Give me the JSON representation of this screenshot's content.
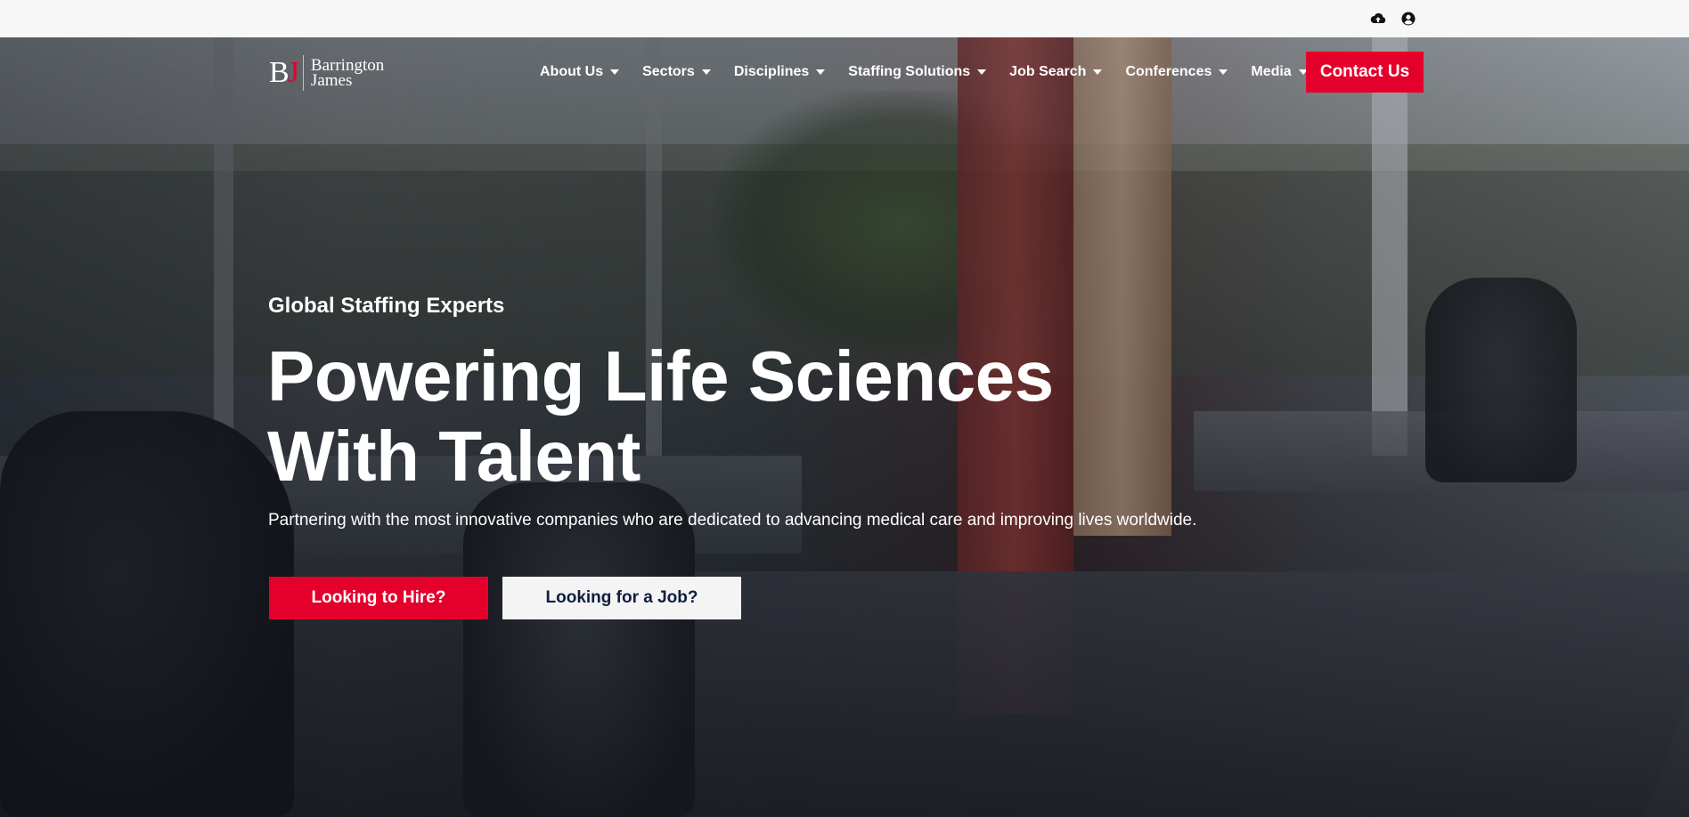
{
  "topbar": {
    "icons": [
      "cloud-upload-icon",
      "user-account-icon"
    ]
  },
  "brand": {
    "mark_b": "B",
    "mark_j": "J",
    "line1": "Barrington",
    "line2": "James",
    "accent_color": "#e4002b"
  },
  "nav": {
    "items": [
      {
        "label": "About Us"
      },
      {
        "label": "Sectors"
      },
      {
        "label": "Disciplines"
      },
      {
        "label": "Staffing Solutions"
      },
      {
        "label": "Job Search"
      },
      {
        "label": "Conferences"
      },
      {
        "label": "Media"
      }
    ],
    "contact_label": "Contact Us"
  },
  "hero": {
    "eyebrow": "Global Staffing Experts",
    "headline_line1": "Powering Life Sciences",
    "headline_line2": "With Talent",
    "subtext": "Partnering with the most innovative companies who are dedicated to advancing medical care and improving lives worldwide.",
    "cta_hire": "Looking to Hire?",
    "cta_job": "Looking for a Job?"
  },
  "colors": {
    "primary_red": "#e4002b",
    "navy": "#0f1e3c",
    "topbar_bg": "#f7f7f7"
  }
}
